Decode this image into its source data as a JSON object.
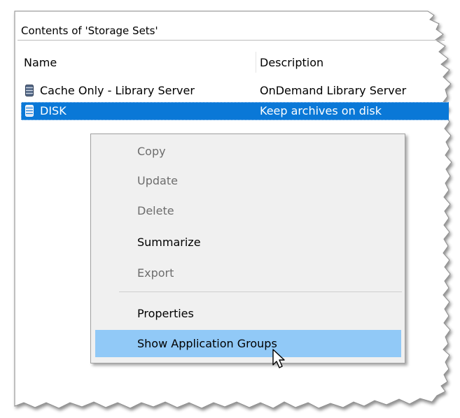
{
  "panel": {
    "title": "Contents of 'Storage Sets'"
  },
  "columns": {
    "name": "Name",
    "description": "Description"
  },
  "rows": [
    {
      "name": "Cache Only - Library Server",
      "description": "OnDemand Library Server",
      "selected": false,
      "icon": "storage-set-icon"
    },
    {
      "name": "DISK",
      "description": "Keep archives on disk",
      "selected": true,
      "icon": "storage-set-icon"
    }
  ],
  "context_menu": {
    "items": [
      {
        "label": "Copy",
        "enabled": false
      },
      {
        "label": "Update",
        "enabled": false
      },
      {
        "label": "Delete",
        "enabled": false
      },
      {
        "label": "Summarize",
        "enabled": true
      },
      {
        "label": "Export",
        "enabled": false
      },
      {
        "label": "Properties",
        "enabled": true
      },
      {
        "label": "Show Application Groups",
        "enabled": true,
        "highlighted": true
      }
    ]
  },
  "colors": {
    "selection": "#0a78d7",
    "menu_highlight": "#91c9f7",
    "menu_background": "#f0f0f0",
    "disabled_text": "#6d6d6d"
  },
  "icons": {
    "cursor": "mouse-pointer-icon"
  }
}
